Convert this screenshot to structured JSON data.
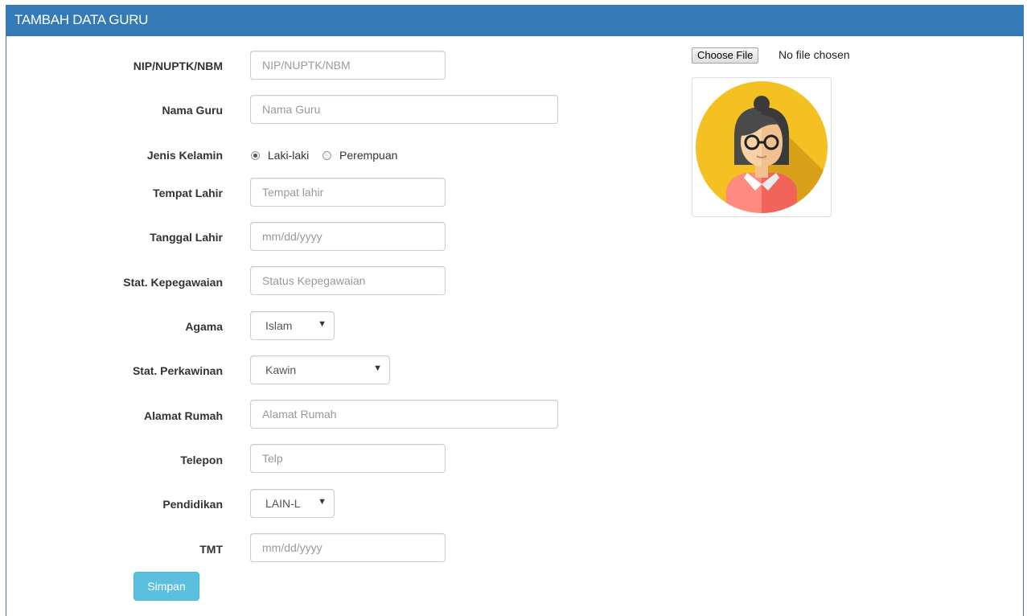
{
  "panel": {
    "title": "TAMBAH DATA GURU"
  },
  "form": {
    "nip": {
      "label": "NIP/NUPTK/NBM",
      "placeholder": "NIP/NUPTK/NBM"
    },
    "nama": {
      "label": "Nama Guru",
      "placeholder": "Nama Guru"
    },
    "jenis_kelamin": {
      "label": "Jenis Kelamin",
      "options": [
        "Laki-laki",
        "Perempuan"
      ],
      "selected": "Laki-laki"
    },
    "tempat_lahir": {
      "label": "Tempat Lahir",
      "placeholder": "Tempat lahir"
    },
    "tanggal_lahir": {
      "label": "Tanggal Lahir",
      "placeholder": "mm/dd/yyyy"
    },
    "status_kepegawaian": {
      "label": "Stat. Kepegawaian",
      "placeholder": "Status Kepegawaian"
    },
    "agama": {
      "label": "Agama",
      "value": "Islam"
    },
    "status_perkawinan": {
      "label": "Stat. Perkawinan",
      "value": "Kawin"
    },
    "alamat": {
      "label": "Alamat Rumah",
      "placeholder": "Alamat Rumah"
    },
    "telepon": {
      "label": "Telepon",
      "placeholder": "Telp"
    },
    "pendidikan": {
      "label": "Pendidikan",
      "value": "LAIN-L"
    },
    "tmt": {
      "label": "TMT",
      "placeholder": "mm/dd/yyyy"
    },
    "submit_label": "Simpan"
  },
  "photo": {
    "file_button_label": "Choose File",
    "file_status": "No file chosen",
    "avatar_icon": "female-teacher-avatar-icon"
  },
  "colors": {
    "header": "#337ab7",
    "button_info": "#5bc0de",
    "avatar_bg": "#f5c022"
  }
}
